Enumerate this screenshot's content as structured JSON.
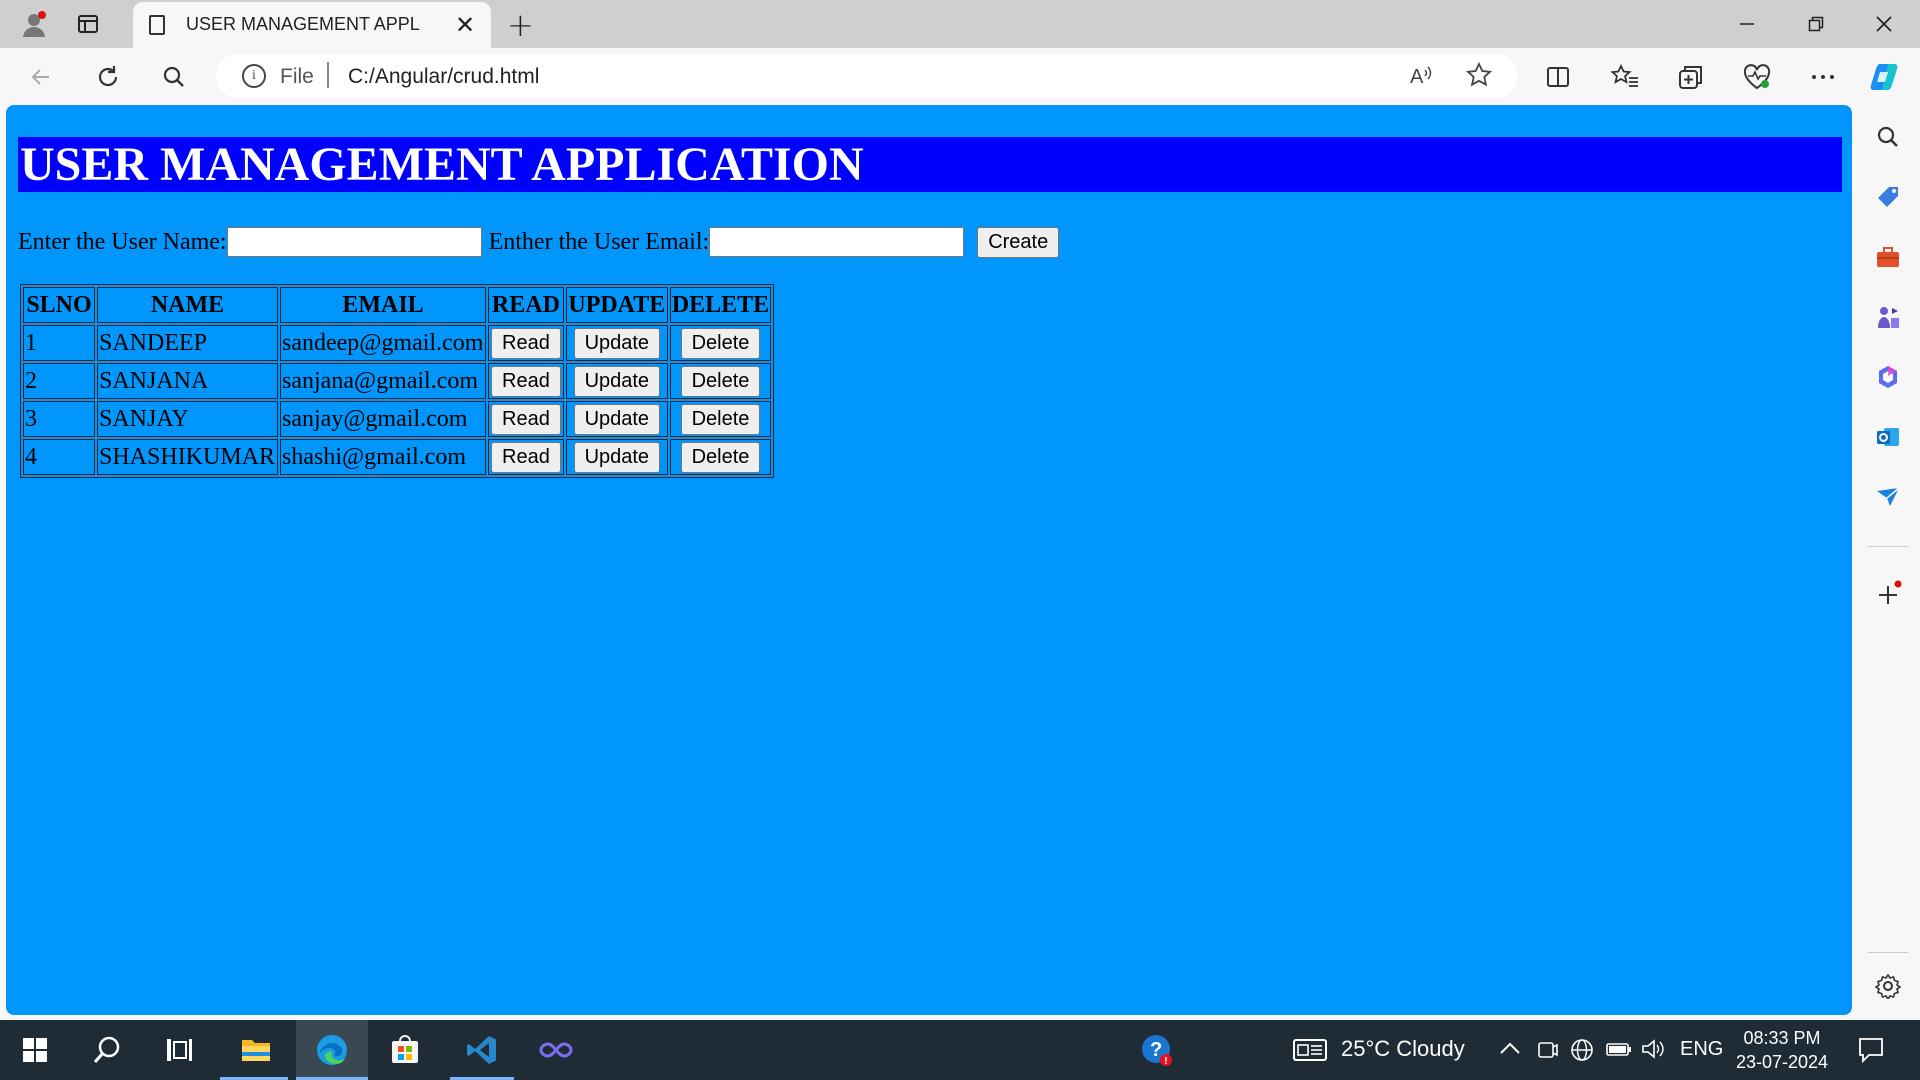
{
  "browser": {
    "tab_title": "USER MANAGEMENT APPLICATI",
    "close_glyph": "✕",
    "new_tab_glyph": "+",
    "protocol_label": "File",
    "url": "C:/Angular/crud.html"
  },
  "page": {
    "heading": "USER MANAGEMENT APPLICATION",
    "form": {
      "name_label": "Enter the User Name:",
      "name_value": "",
      "email_label": "Enther the User Email:",
      "email_value": "",
      "create_label": "Create"
    },
    "table": {
      "headers": [
        "SLNO",
        "NAME",
        "EMAIL",
        "READ",
        "UPDATE",
        "DELETE"
      ],
      "rows": [
        {
          "slno": "1",
          "name": "SANDEEP",
          "email": "sandeep@gmail.com"
        },
        {
          "slno": "2",
          "name": "SANJANA",
          "email": "sanjana@gmail.com"
        },
        {
          "slno": "3",
          "name": "SANJAY",
          "email": "sanjay@gmail.com"
        },
        {
          "slno": "4",
          "name": "SHASHIKUMAR",
          "email": "shashi@gmail.com"
        }
      ],
      "read_label": "Read",
      "update_label": "Update",
      "delete_label": "Delete"
    }
  },
  "taskbar": {
    "weather": "25°C  Cloudy",
    "language": "ENG",
    "time": "08:33 PM",
    "date": "23-07-2024"
  },
  "colors": {
    "page_background": "#0096fb",
    "banner_background": "#0000ff",
    "heading_text": "#ffffff"
  }
}
